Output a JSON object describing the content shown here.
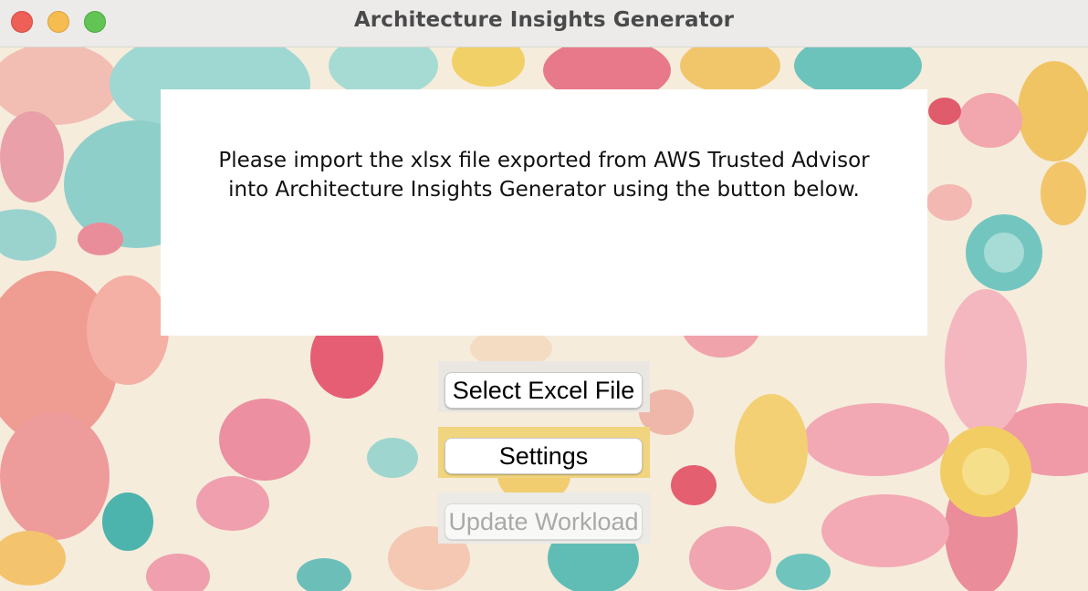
{
  "window": {
    "title": "Architecture Insights Generator"
  },
  "message": {
    "text": "Please import the xlsx file exported from AWS Trusted Advisor into Architecture Insights Generator using the button below."
  },
  "buttons": {
    "select_excel": {
      "label": "Select Excel File",
      "enabled": true
    },
    "settings": {
      "label": "Settings",
      "enabled": true
    },
    "update_workload": {
      "label": "Update Workload",
      "enabled": false
    }
  },
  "icons": {
    "close": "close-circle",
    "minimize": "minimize-circle",
    "zoom": "zoom-circle"
  },
  "colors": {
    "close": "#ee5f57",
    "minimize": "#f5bd4f",
    "zoom": "#61c454",
    "background_cream": "#f6efe2"
  }
}
